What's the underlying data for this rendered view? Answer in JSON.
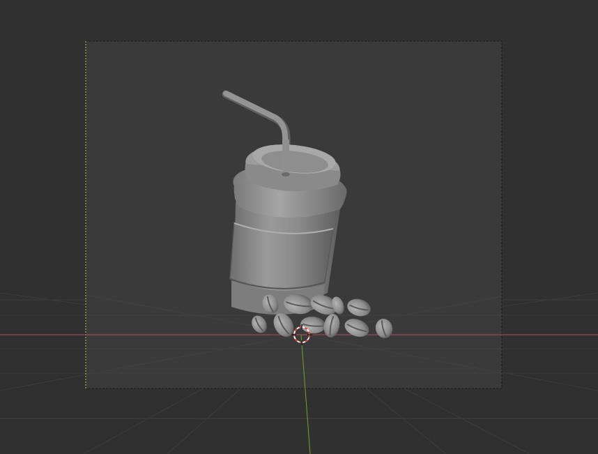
{
  "viewport": {
    "view": "camera",
    "shading": "solid",
    "background_color": "#303030",
    "camera_frame_fill": "#3a3a3a",
    "object_color": "#8e8e8e",
    "x_axis_color": "#b8485a",
    "y_axis_color": "#6fa334",
    "grid_color": "#3a3a3a",
    "cursor_color": "#e0402f"
  },
  "icons": {
    "cursor": "3d-cursor-icon",
    "camera_frame": "camera-border",
    "object": "coffee-cup-mesh"
  }
}
